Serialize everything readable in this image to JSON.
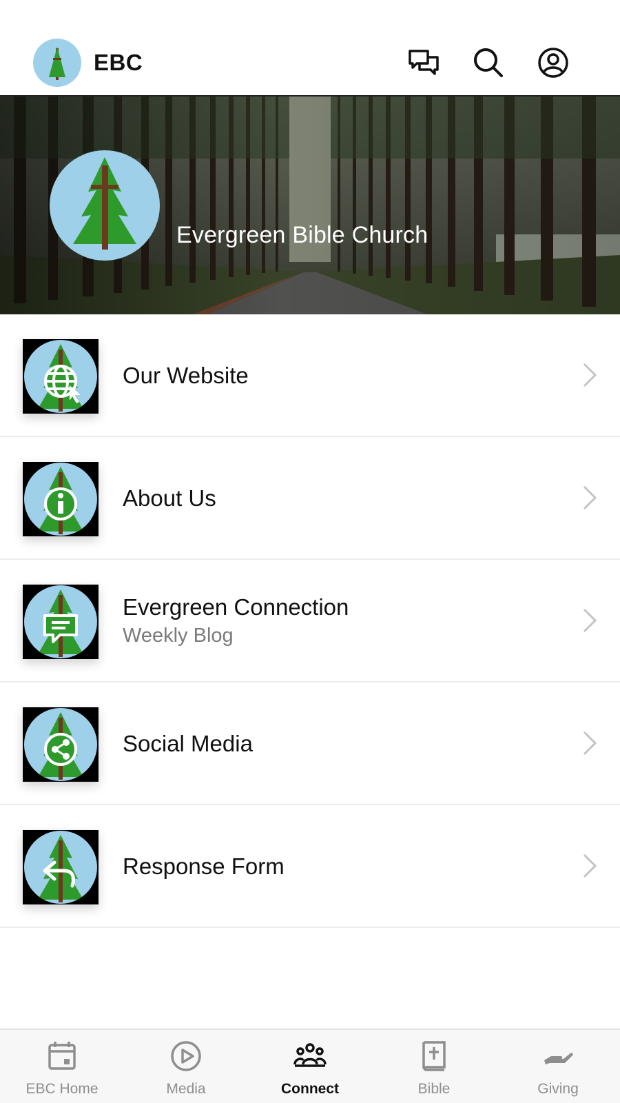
{
  "header": {
    "title": "EBC",
    "icons": [
      "chat-icon",
      "search-icon",
      "profile-icon"
    ]
  },
  "hero": {
    "title": "Evergreen Bible Church"
  },
  "menu": {
    "items": [
      {
        "label": "Our Website",
        "sublabel": "",
        "icon": "globe-icon"
      },
      {
        "label": "About Us",
        "sublabel": "",
        "icon": "info-icon"
      },
      {
        "label": "Evergreen Connection",
        "sublabel": "Weekly Blog",
        "icon": "blog-icon"
      },
      {
        "label": "Social Media",
        "sublabel": "",
        "icon": "share-icon"
      },
      {
        "label": "Response Form",
        "sublabel": "",
        "icon": "reply-icon"
      }
    ]
  },
  "tabs": [
    {
      "label": "EBC Home",
      "icon": "calendar-icon",
      "active": false
    },
    {
      "label": "Media",
      "icon": "play-icon",
      "active": false
    },
    {
      "label": "Connect",
      "icon": "people-icon",
      "active": true
    },
    {
      "label": "Bible",
      "icon": "bible-icon",
      "active": false
    },
    {
      "label": "Giving",
      "icon": "giving-icon",
      "active": false
    }
  ],
  "colors": {
    "accent": "#111111",
    "inactive": "#8e8e8e",
    "logo_bg": "#9ed0ea",
    "tree_green": "#2f9a2c",
    "trunk": "#6b3a1e"
  }
}
